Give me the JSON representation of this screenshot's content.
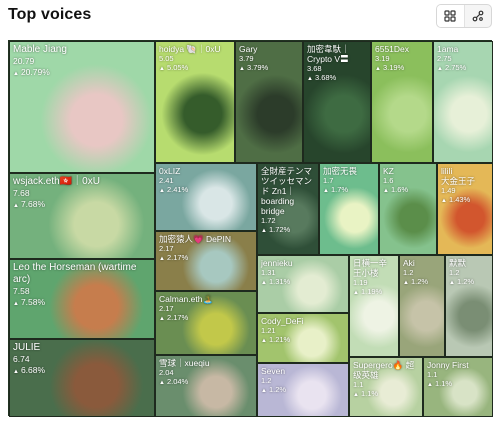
{
  "header": {
    "title": "Top voices",
    "views": [
      {
        "icon": "grid-view-icon",
        "active": true
      },
      {
        "icon": "network-view-icon",
        "active": false
      }
    ]
  },
  "tiles": [
    {
      "name": "Mable Jiang",
      "score": "20.79",
      "change": "20.79%",
      "bg": "#9fd8a8",
      "accent": "#e8c7c4"
    },
    {
      "name": "hoidya 🐚｜0xU",
      "score": "5.05",
      "change": "5.05%",
      "bg": "#b7dc6f",
      "accent": "#355c2b"
    },
    {
      "name": "Gary",
      "score": "3.79",
      "change": "3.79%",
      "bg": "#4f6e45",
      "accent": "#2c3c2a"
    },
    {
      "name": "加密韋馱｜Crypto V〓",
      "score": "3.68",
      "change": "3.68%",
      "bg": "#27452c",
      "accent": "#3e6b42"
    },
    {
      "name": "6551Dex",
      "score": "3.19",
      "change": "3.19%",
      "bg": "#8bbf5c",
      "accent": "#b4d98a"
    },
    {
      "name": "1ama",
      "score": "2.75",
      "change": "2.75%",
      "bg": "#a7d6b1",
      "accent": "#e7f0d8"
    },
    {
      "name": "wsjack.eth🇭🇰｜0xU",
      "score": "7.68",
      "change": "7.68%",
      "bg": "#74b17d",
      "accent": "#c8d9a4"
    },
    {
      "name": "0xLIZ",
      "score": "2.41",
      "change": "2.41%",
      "bg": "#7aa7a0",
      "accent": "#d9e6e6"
    },
    {
      "name": "全財産テンマツイッセマンド Zn1｜boarding bridge",
      "score": "1.72",
      "change": "1.72%",
      "bg": "#2f4f38",
      "accent": "#587a5e"
    },
    {
      "name": "加密无畏",
      "score": "1.7",
      "change": "1.7%",
      "bg": "#6dbd8d",
      "accent": "#e9f3c4"
    },
    {
      "name": "KZ",
      "score": "1.6",
      "change": "1.6%",
      "bg": "#85c28d",
      "accent": "#5b8e4a"
    },
    {
      "name": "lilili",
      "score": "1.49",
      "change": "1.43%",
      "bg": "#e4b857",
      "accent": "#d2562e"
    },
    {
      "name": "大金王子",
      "score": "",
      "change": "",
      "bg": "#e4b857",
      "accent": "#d2562e"
    },
    {
      "name": "加密猿人💗 DePIN",
      "score": "2.17",
      "change": "2.17%",
      "bg": "#8a7f4a",
      "accent": "#a7c8c0"
    },
    {
      "name": "Leo the Horseman (wartime arc)",
      "score": "7.58",
      "change": "7.58%",
      "bg": "#5fa56e",
      "accent": "#c67d4d"
    },
    {
      "name": "Calman.eth🏝️",
      "score": "2.17",
      "change": "2.17%",
      "bg": "#6a8e52",
      "accent": "#c2c84a"
    },
    {
      "name": "jennieku",
      "score": "1.31",
      "change": "1.31%",
      "bg": "#aacda6",
      "accent": "#e3ecd2"
    },
    {
      "name": "日横一辛 王小楼",
      "score": "1.19",
      "change": "1.19%",
      "bg": "#c2ddb6",
      "accent": "#eef3e4"
    },
    {
      "name": "Aki",
      "score": "1.2",
      "change": "1.2%",
      "bg": "#99a57a",
      "accent": "#c6c3a8"
    },
    {
      "name": "默默",
      "score": "1.2",
      "change": "1.2%",
      "bg": "#b9c8b4",
      "accent": "#7a8e74"
    },
    {
      "name": "Cody_DeFi",
      "score": "1.21",
      "change": "1.21%",
      "bg": "#a2c46d",
      "accent": "#e8f0c8"
    },
    {
      "name": "JULIE",
      "score": "6.74",
      "change": "6.68%",
      "bg": "#4a6e4c",
      "accent": "#8a5a3c"
    },
    {
      "name": "雪球｜xueqiu",
      "score": "2.04",
      "change": "2.04%",
      "bg": "#6a8e6d",
      "accent": "#c7b8a4"
    },
    {
      "name": "Seven",
      "score": "1.2",
      "change": "1.2%",
      "bg": "#b9b7d5",
      "accent": "#e9e3f0"
    },
    {
      "name": "Supergero🔥 超级英雄",
      "score": "1.1",
      "change": "1.1%",
      "bg": "#b7d1a1",
      "accent": "#e8ecd5"
    },
    {
      "name": "Jonny First",
      "score": "1.1",
      "change": "1.1%",
      "bg": "#98b57e",
      "accent": "#d8e3c6"
    }
  ]
}
